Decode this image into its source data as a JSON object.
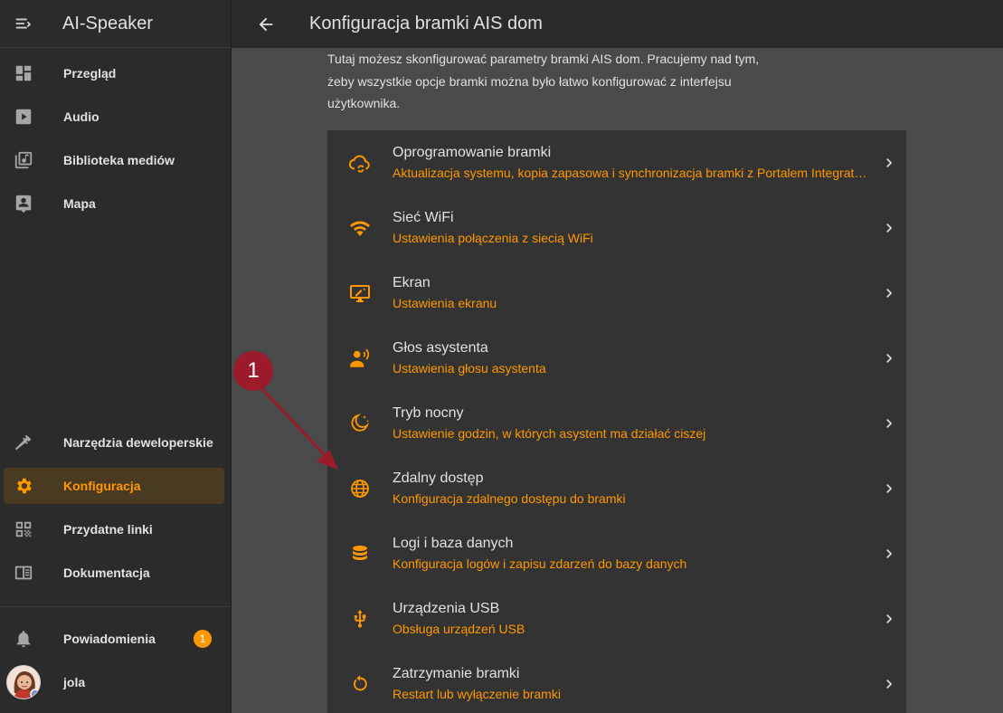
{
  "app": {
    "title": "AI-Speaker"
  },
  "sidebar": {
    "items": [
      {
        "label": "Przegląd",
        "icon": "dashboard-icon"
      },
      {
        "label": "Audio",
        "icon": "play-box-icon"
      },
      {
        "label": "Biblioteka mediów",
        "icon": "music-library-icon"
      },
      {
        "label": "Mapa",
        "icon": "account-box-icon"
      }
    ],
    "bottom_items": [
      {
        "label": "Narzędzia deweloperskie",
        "icon": "hammer-icon"
      },
      {
        "label": "Konfiguracja",
        "icon": "gear-icon",
        "active": true
      },
      {
        "label": "Przydatne linki",
        "icon": "qrcode-icon"
      },
      {
        "label": "Dokumentacja",
        "icon": "book-icon"
      }
    ],
    "notifications": {
      "label": "Powiadomienia",
      "count": "1"
    },
    "user": {
      "name": "jola"
    }
  },
  "header": {
    "title": "Konfiguracja bramki AIS dom"
  },
  "intro": {
    "line1": "Tutaj możesz skonfigurować parametry bramki AIS dom. Pracujemy nad tym,",
    "line2": "żeby wszystkie opcje bramki można było łatwo konfigurować z interfejsu",
    "line3": "użytkownika."
  },
  "settings": [
    {
      "title": "Oprogramowanie bramki",
      "subtitle": "Aktualizacja systemu, kopia zapasowa i synchronizacja bramki z Portalem Integrat…",
      "icon": "cloud-sync-icon"
    },
    {
      "title": "Sieć WiFi",
      "subtitle": "Ustawienia połączenia z siecią WiFi",
      "icon": "wifi-icon"
    },
    {
      "title": "Ekran",
      "subtitle": "Ustawienia ekranu",
      "icon": "monitor-icon"
    },
    {
      "title": "Głos asystenta",
      "subtitle": "Ustawienia głosu asystenta",
      "icon": "voice-icon"
    },
    {
      "title": "Tryb nocny",
      "subtitle": "Ustawienie godzin, w których asystent ma działać ciszej",
      "icon": "moon-icon"
    },
    {
      "title": "Zdalny dostęp",
      "subtitle": "Konfiguracja zdalnego dostępu do bramki",
      "icon": "globe-icon"
    },
    {
      "title": "Logi i baza danych",
      "subtitle": "Konfiguracja logów i zapisu zdarzeń do bazy danych",
      "icon": "database-icon"
    },
    {
      "title": "Urządzenia USB",
      "subtitle": "Obsługa urządzeń USB",
      "icon": "usb-icon"
    },
    {
      "title": "Zatrzymanie bramki",
      "subtitle": "Restart lub wyłączenie bramki",
      "icon": "restart-icon"
    }
  ],
  "annotation": {
    "label": "1"
  },
  "colors": {
    "accent": "#ff9800",
    "sidebar_bg": "#2b2b2b",
    "card_bg": "#333333",
    "marker": "#9c1b2b"
  }
}
